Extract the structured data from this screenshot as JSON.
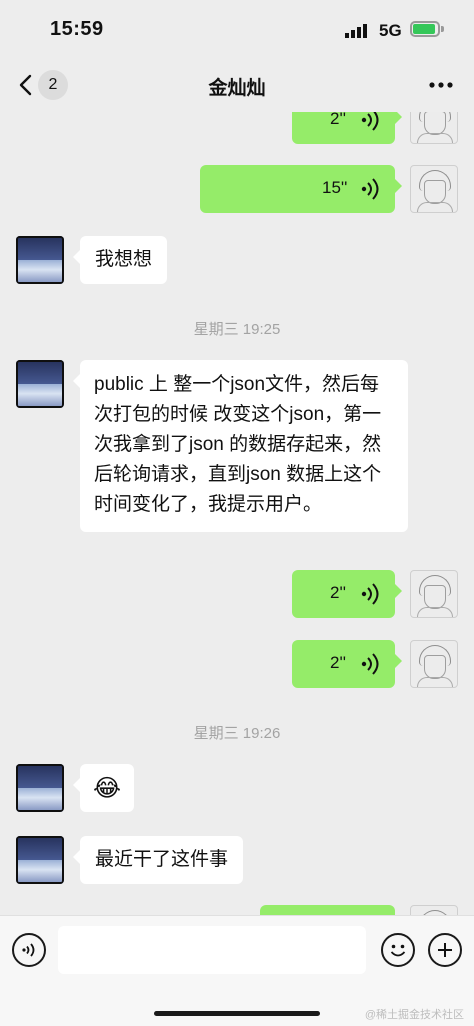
{
  "status_bar": {
    "time": "15:59",
    "network": "5G"
  },
  "nav": {
    "unread_count": "2",
    "title": "金灿灿"
  },
  "messages": [
    {
      "kind": "voice",
      "side": "right",
      "duration": "2''"
    },
    {
      "kind": "voice",
      "side": "right",
      "duration": "15''"
    },
    {
      "kind": "text",
      "side": "left",
      "text": "我想想"
    },
    {
      "kind": "time",
      "text": "星期三 19:25"
    },
    {
      "kind": "text",
      "side": "left",
      "text": "public 上 整一个json文件，然后每次打包的时候 改变这个json，第一次我拿到了json 的数据存起来，然后轮询请求，直到json 数据上这个时间变化了，我提示用户。"
    },
    {
      "kind": "voice",
      "side": "right",
      "duration": "2''"
    },
    {
      "kind": "voice",
      "side": "right",
      "duration": "2''"
    },
    {
      "kind": "time",
      "text": "星期三 19:26"
    },
    {
      "kind": "emoji",
      "side": "left",
      "text": "😂"
    },
    {
      "kind": "text",
      "side": "left",
      "text": "最近干了这件事"
    }
  ],
  "input": {
    "value": ""
  },
  "watermark": "@稀土掘金技术社区",
  "colors": {
    "bubble_sent": "#95ec69",
    "bubble_received": "#ffffff",
    "background": "#ededed"
  }
}
